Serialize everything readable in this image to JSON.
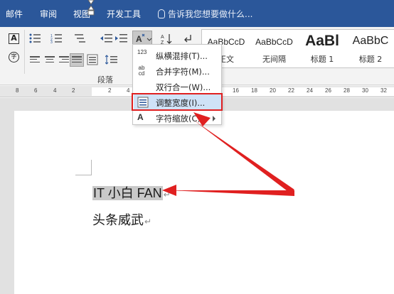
{
  "ribbon_tabs": [
    "邮件",
    "审阅",
    "视图",
    "开发工具"
  ],
  "tell_me": "告诉我您想要做什么...",
  "group_label": "段落",
  "styles": [
    {
      "sample": "AaBbCcD",
      "name": "正文"
    },
    {
      "sample": "AaBbCcD",
      "name": "无间隔"
    },
    {
      "sample": "AaBl",
      "name": "标题 1"
    },
    {
      "sample": "AaBbC",
      "name": "标题 2"
    }
  ],
  "ribbon_glyphs": {
    "asian_layout": "A",
    "sort": "A↓",
    "pilcrow": "↵",
    "char_box": "A",
    "enclose": "字"
  },
  "ruler_ticks": [
    "8",
    "6",
    "4",
    "2",
    "2",
    "4",
    "16",
    "18",
    "20",
    "22",
    "24",
    "26",
    "28",
    "30",
    "32"
  ],
  "menu": {
    "items": [
      {
        "icon": "123",
        "label": "纵横混排(T)..."
      },
      {
        "icon": "ab cd",
        "label": "合并字符(M)..."
      },
      {
        "icon": "",
        "label": "双行合一(W)..."
      },
      {
        "icon": "",
        "label": "调整宽度(I)..."
      },
      {
        "icon": "A",
        "label": "字符缩放(C)"
      }
    ],
    "active_index": 3
  },
  "document": {
    "line1": "IT 小白 FAN",
    "line2": "头条威武",
    "paragraph_mark": "↵"
  },
  "colors": {
    "tabbar": "#2b579a",
    "annotation": "#e02020",
    "menu_highlight": "#cfe2f7",
    "text_highlight": "#c9c9c9"
  },
  "icons": [
    "asian-layout-icon",
    "lightbulb-icon",
    "distributed-icon",
    "sort-icon",
    "pilcrow-icon"
  ]
}
